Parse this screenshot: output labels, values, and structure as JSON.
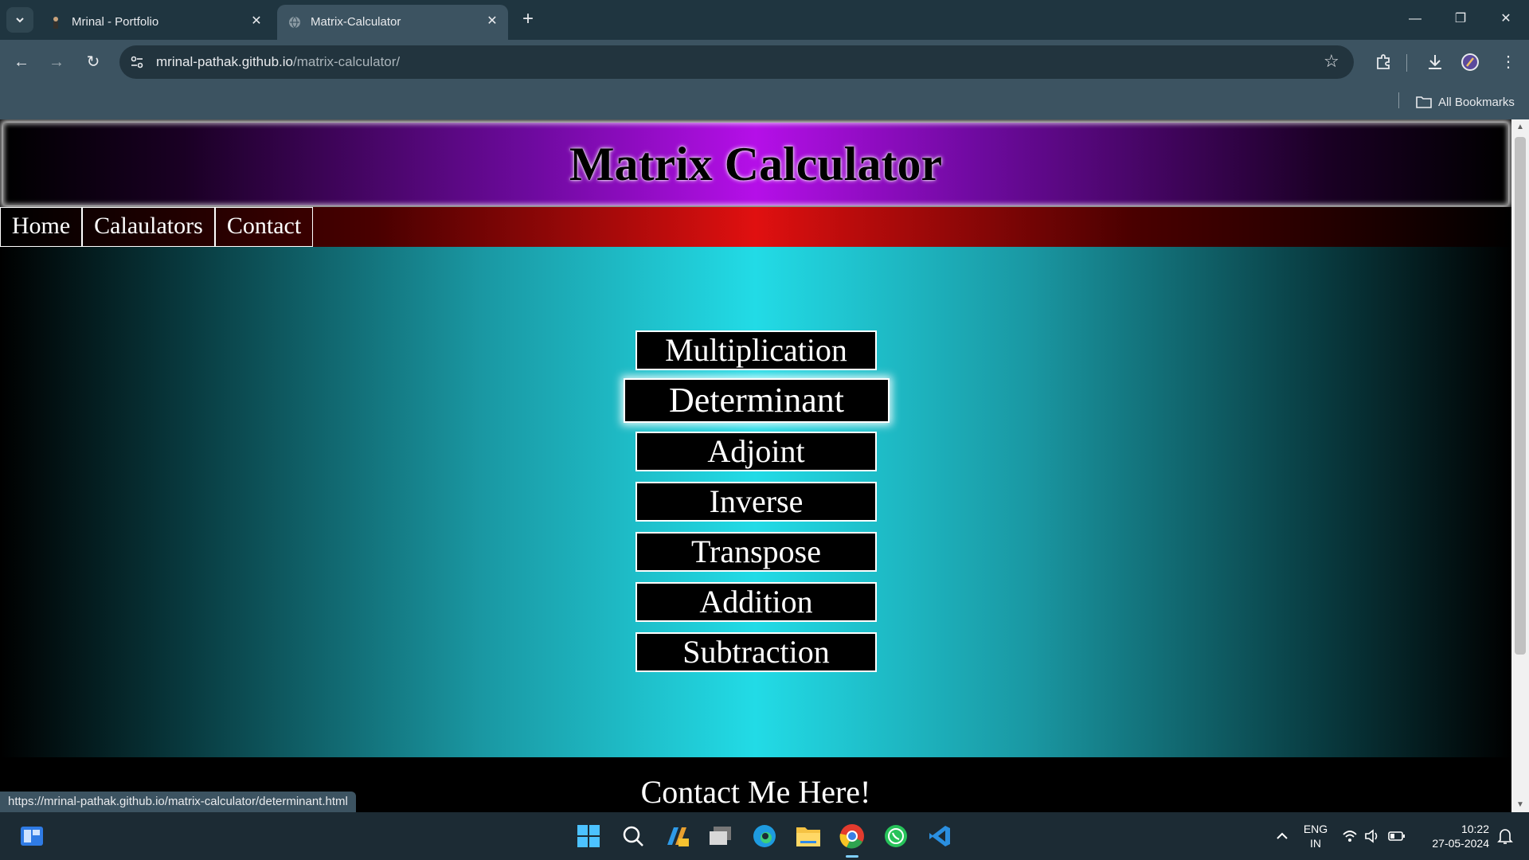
{
  "browser": {
    "tabs": [
      {
        "title": "Mrinal - Portfolio",
        "active": false
      },
      {
        "title": "Matrix-Calculator",
        "active": true
      }
    ],
    "url_host": "mrinal-pathak.github.io",
    "url_path": "/matrix-calculator/",
    "bookmarks_label": "All Bookmarks",
    "status_url": "https://mrinal-pathak.github.io/matrix-calculator/determinant.html"
  },
  "site": {
    "title": "Matrix Calculator",
    "nav": [
      "Home",
      "Calaulators",
      "Contact"
    ],
    "calculators": [
      "Multiplication",
      "Determinant",
      "Adjoint",
      "Inverse",
      "Transpose",
      "Addition",
      "Subtraction"
    ],
    "hovered_calculator": "Determinant",
    "footer_heading": "Contact Me Here!"
  },
  "taskbar": {
    "language": "ENG",
    "region": "IN",
    "time": "10:22",
    "date": "27-05-2024"
  },
  "colors": {
    "header_accent": "#b50fe8",
    "nav_accent": "#e01010",
    "main_accent": "#22dbe6"
  }
}
